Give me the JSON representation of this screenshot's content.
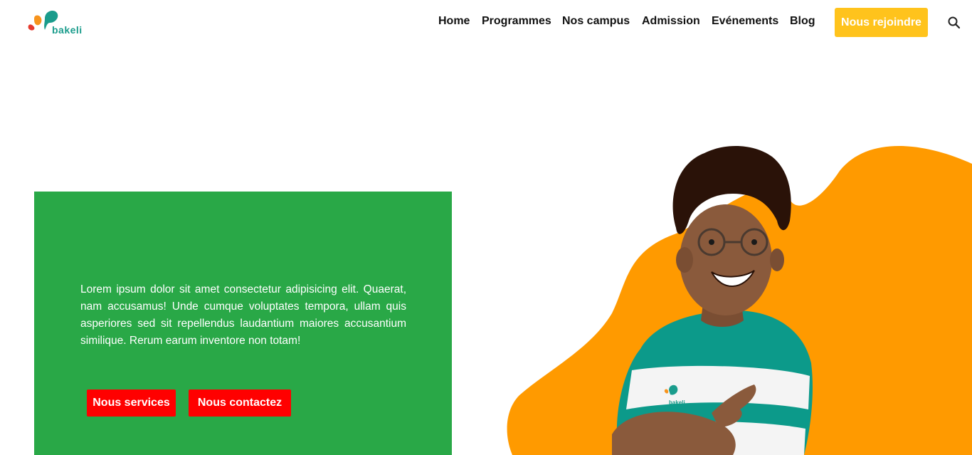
{
  "logo": {
    "text": "bakeli",
    "colors": {
      "teal": "#1a9c8c",
      "orange": "#f7941d",
      "red": "#e63a2e"
    }
  },
  "nav": {
    "items": [
      "Home",
      "Programmes",
      "Nos campus",
      "Admission",
      "Evénements",
      "Blog"
    ],
    "cta_label": "Nous rejoindre",
    "search_icon": "search-icon"
  },
  "hero": {
    "paragraph": "Lorem ipsum dolor sit amet consectetur adipisicing elit. Quaerat, nam accusamus! Unde cumque voluptates tempora, ullam quis asperiores sed sit repellendus laudantium maiores accusantium similique. Rerum earum inventore non totam!",
    "buttons": {
      "services": "Nous services",
      "contact": "Nous contactez"
    },
    "illustration_badge": "bakeli"
  },
  "colors": {
    "green": "#29a847",
    "yellow": "#ffc31c",
    "red": "#ff0000",
    "orange": "#ff9a00",
    "teal": "#0c9a8a"
  }
}
